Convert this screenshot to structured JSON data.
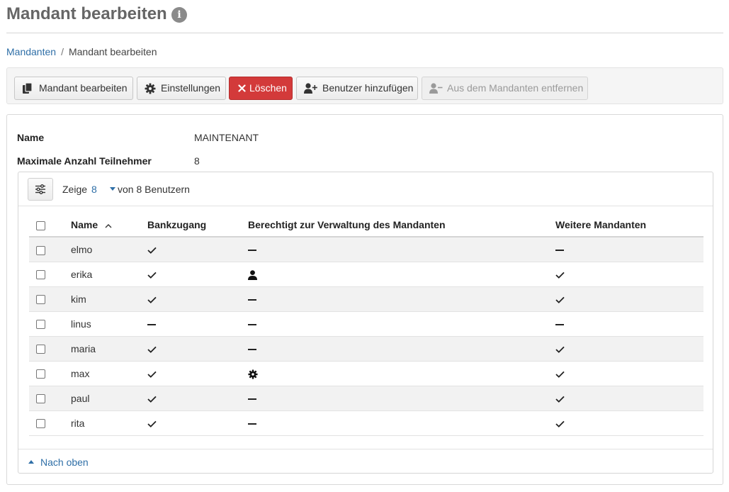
{
  "page": {
    "title": "Mandant bearbeiten"
  },
  "breadcrumb": {
    "parent": "Mandanten",
    "separator": "/",
    "current": "Mandant bearbeiten"
  },
  "toolbar": {
    "edit": "Mandant bearbeiten",
    "settings": "Einstellungen",
    "delete": "Löschen",
    "add_user": "Benutzer hinzufügen",
    "remove": "Aus dem Mandanten entfernen"
  },
  "details": {
    "name_label": "Name",
    "name_value": "MAINTENANT",
    "max_label": "Maximale Anzahl Teilnehmer",
    "max_value": "8"
  },
  "list": {
    "show_prefix": "Zeige",
    "page_size": "8",
    "show_suffix": "von 8 Benutzern",
    "columns": [
      "Name",
      "Bankzugang",
      "Berechtigt zur Verwaltung des Mandanten",
      "Weitere Mandanten"
    ],
    "rows": [
      {
        "name": "elmo",
        "bank": "check",
        "rights": "dash",
        "other": "dash"
      },
      {
        "name": "erika",
        "bank": "check",
        "rights": "user-icon",
        "other": "check"
      },
      {
        "name": "kim",
        "bank": "check",
        "rights": "dash",
        "other": "check"
      },
      {
        "name": "linus",
        "bank": "dash",
        "rights": "dash",
        "other": "dash"
      },
      {
        "name": "maria",
        "bank": "check",
        "rights": "dash",
        "other": "check"
      },
      {
        "name": "max",
        "bank": "check",
        "rights": "gear-icon",
        "other": "check"
      },
      {
        "name": "paul",
        "bank": "check",
        "rights": "dash",
        "other": "check"
      },
      {
        "name": "rita",
        "bank": "check",
        "rights": "dash",
        "other": "check"
      }
    ],
    "back_to_top": "Nach oben"
  },
  "colors": {
    "link": "#2f6fa7",
    "danger": "#d33a3a",
    "stripe": "#f2f2f2"
  }
}
